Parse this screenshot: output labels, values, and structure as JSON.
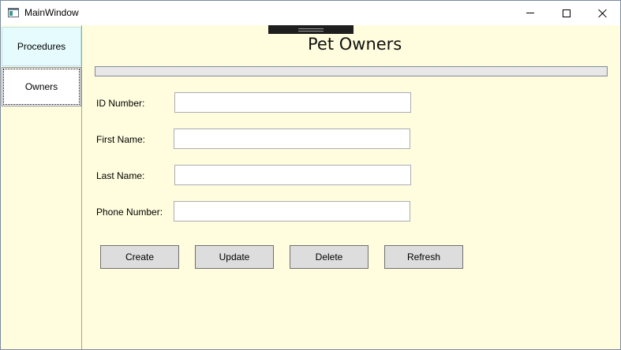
{
  "window": {
    "title": "MainWindow",
    "controls": {
      "minimize": "minimize-icon",
      "maximize": "maximize-icon",
      "close": "close-icon"
    }
  },
  "nav": {
    "items": [
      {
        "label": "Procedures"
      },
      {
        "label": "Owners"
      }
    ]
  },
  "page": {
    "title": "Pet Owners",
    "progress": 0
  },
  "form": {
    "fields": [
      {
        "label": "ID Number:",
        "value": "",
        "placeholder": ""
      },
      {
        "label": "First Name:",
        "value": "",
        "placeholder": ""
      },
      {
        "label": "Last Name:",
        "value": "",
        "placeholder": ""
      },
      {
        "label": "Phone Number:",
        "value": "",
        "placeholder": ""
      }
    ]
  },
  "actions": {
    "create": "Create",
    "update": "Update",
    "delete": "Delete",
    "refresh": "Refresh"
  },
  "colors": {
    "background": "#fffddd",
    "nav_selected": "#e6fbfd",
    "button": "#dddddd"
  }
}
